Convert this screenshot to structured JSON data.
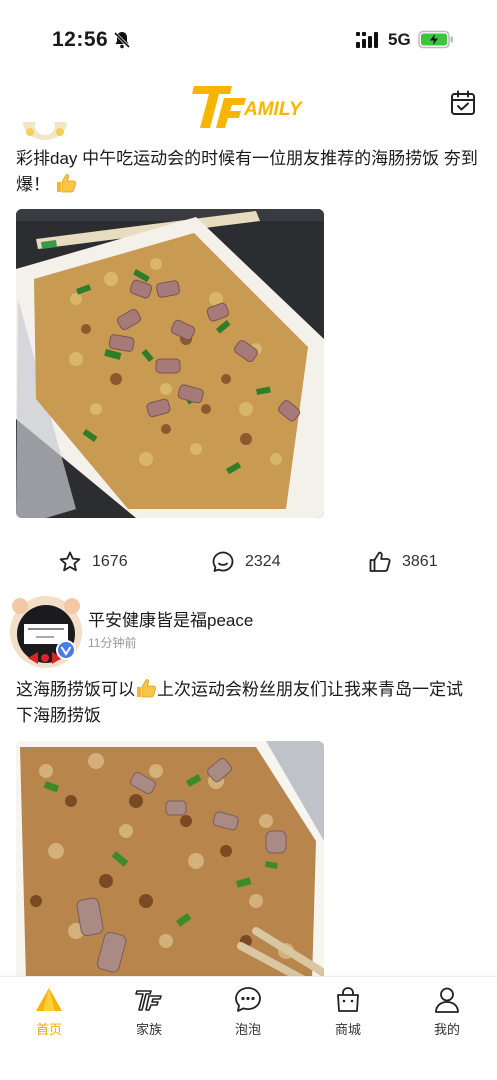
{
  "status_bar": {
    "time": "12:56",
    "network": "5G",
    "icons": [
      "bell-muted-icon",
      "signal-icon",
      "battery-charging-icon"
    ]
  },
  "header": {
    "logo_text": "TFAMILY",
    "icons": [
      "calendar-icon"
    ]
  },
  "colors": {
    "accent": "#f5a800",
    "battery_green": "#3cc43c",
    "text_primary": "#1a1a1a",
    "text_secondary": "#999999"
  },
  "posts": [
    {
      "text": "彩排day 中午吃运动会的时候有一位朋友推荐的海肠捞饭 夯到爆！",
      "emoji": "thumbs-up-icon",
      "image": "tray of rice with sea worm and greens",
      "actions": {
        "favorite_count": "1676",
        "comment_count": "2324",
        "like_count": "3861"
      }
    },
    {
      "author": "平安健康皆是福peace",
      "time": "11分钟前",
      "text_before_emoji": "这海肠捞饭可以",
      "emoji": "thumbs-up-icon",
      "text_after_emoji": "上次运动会粉丝朋友们让我来青岛一定试下海肠捞饭",
      "image": "plastic box of fried rice with sea worm"
    }
  ],
  "tab_bar": {
    "tabs": [
      {
        "label": "首页",
        "icon": "home-icon",
        "active": true
      },
      {
        "label": "家族",
        "icon": "tf-family-icon",
        "active": false
      },
      {
        "label": "泡泡",
        "icon": "chat-bubble-icon",
        "active": false
      },
      {
        "label": "商城",
        "icon": "shopping-bag-icon",
        "active": false
      },
      {
        "label": "我的",
        "icon": "profile-icon",
        "active": false
      }
    ]
  }
}
